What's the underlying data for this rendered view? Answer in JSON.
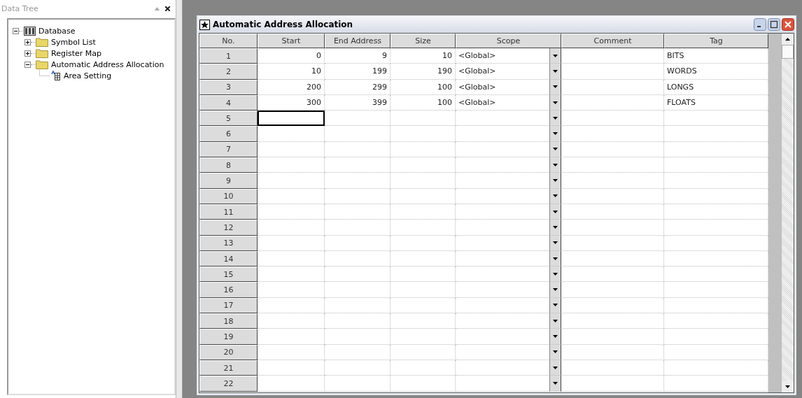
{
  "panel": {
    "title": "Data Tree"
  },
  "tree": [
    {
      "label": "Database",
      "kind": "database",
      "expanded": true,
      "children": [
        {
          "label": "Symbol List",
          "kind": "folder",
          "expanded": false
        },
        {
          "label": "Register Map",
          "kind": "folder",
          "expanded": false
        },
        {
          "label": "Automatic Address Allocation",
          "kind": "folder",
          "expanded": true,
          "children": [
            {
              "label": "Area Setting",
              "kind": "setting"
            }
          ]
        }
      ]
    }
  ],
  "window": {
    "title": "Automatic Address Allocation"
  },
  "table": {
    "columns": [
      "No.",
      "Start",
      "End Address",
      "Size",
      "Scope",
      "Comment",
      "Tag"
    ],
    "rows": [
      {
        "no": "1",
        "start": "0",
        "end_address": "9",
        "size": "10",
        "scope": "<Global>",
        "tag": "BITS",
        "selected": false
      },
      {
        "no": "2",
        "start": "10",
        "end_address": "199",
        "size": "190",
        "scope": "<Global>",
        "tag": "WORDS",
        "selected": false
      },
      {
        "no": "3",
        "start": "200",
        "end_address": "299",
        "size": "100",
        "scope": "<Global>",
        "tag": "LONGS",
        "selected": false
      },
      {
        "no": "4",
        "start": "300",
        "end_address": "399",
        "size": "100",
        "scope": "<Global>",
        "tag": "FLOATS",
        "selected": false
      },
      {
        "no": "5",
        "selected": true
      },
      {
        "no": "6",
        "selected": false
      },
      {
        "no": "7",
        "selected": false
      },
      {
        "no": "8",
        "selected": false
      },
      {
        "no": "9",
        "selected": false
      },
      {
        "no": "10",
        "selected": false
      },
      {
        "no": "11",
        "selected": false
      },
      {
        "no": "12",
        "selected": false
      },
      {
        "no": "13",
        "selected": false
      },
      {
        "no": "14",
        "selected": false
      },
      {
        "no": "15",
        "selected": false
      },
      {
        "no": "16",
        "selected": false
      },
      {
        "no": "17",
        "selected": false
      },
      {
        "no": "18",
        "selected": false
      },
      {
        "no": "19",
        "selected": false
      },
      {
        "no": "20",
        "selected": false
      },
      {
        "no": "21",
        "selected": false
      },
      {
        "no": "22",
        "selected": false
      }
    ]
  }
}
